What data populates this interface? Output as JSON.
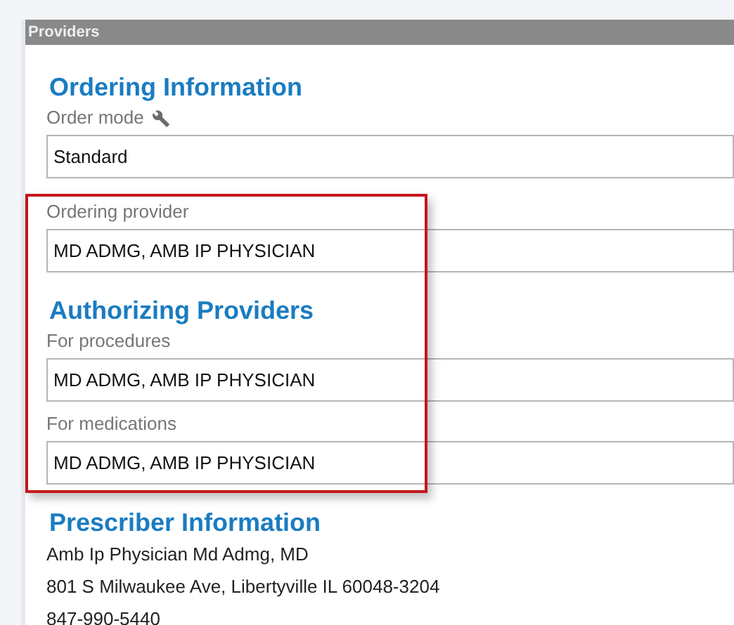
{
  "window": {
    "title": "Providers"
  },
  "sections": [
    {
      "heading": "Ordering Information",
      "fields": [
        {
          "kind": "with-settings",
          "label": "Order mode",
          "value": "Standard"
        },
        {
          "kind": "plain",
          "label": "Ordering provider",
          "value": "MD ADMG, AMB IP PHYSICIAN"
        }
      ]
    },
    {
      "heading": "Authorizing Providers",
      "fields": [
        {
          "kind": "plain",
          "label": "For procedures",
          "value": "MD ADMG, AMB IP PHYSICIAN"
        },
        {
          "kind": "plain",
          "label": "For medications",
          "value": "MD ADMG, AMB IP PHYSICIAN"
        }
      ]
    }
  ],
  "prescriber": {
    "heading": "Prescriber Information",
    "lines": [
      "Amb Ip Physician Md Admg, MD",
      "801 S Milwaukee Ave, Libertyville IL 60048-3204",
      "847-990-5440"
    ]
  }
}
